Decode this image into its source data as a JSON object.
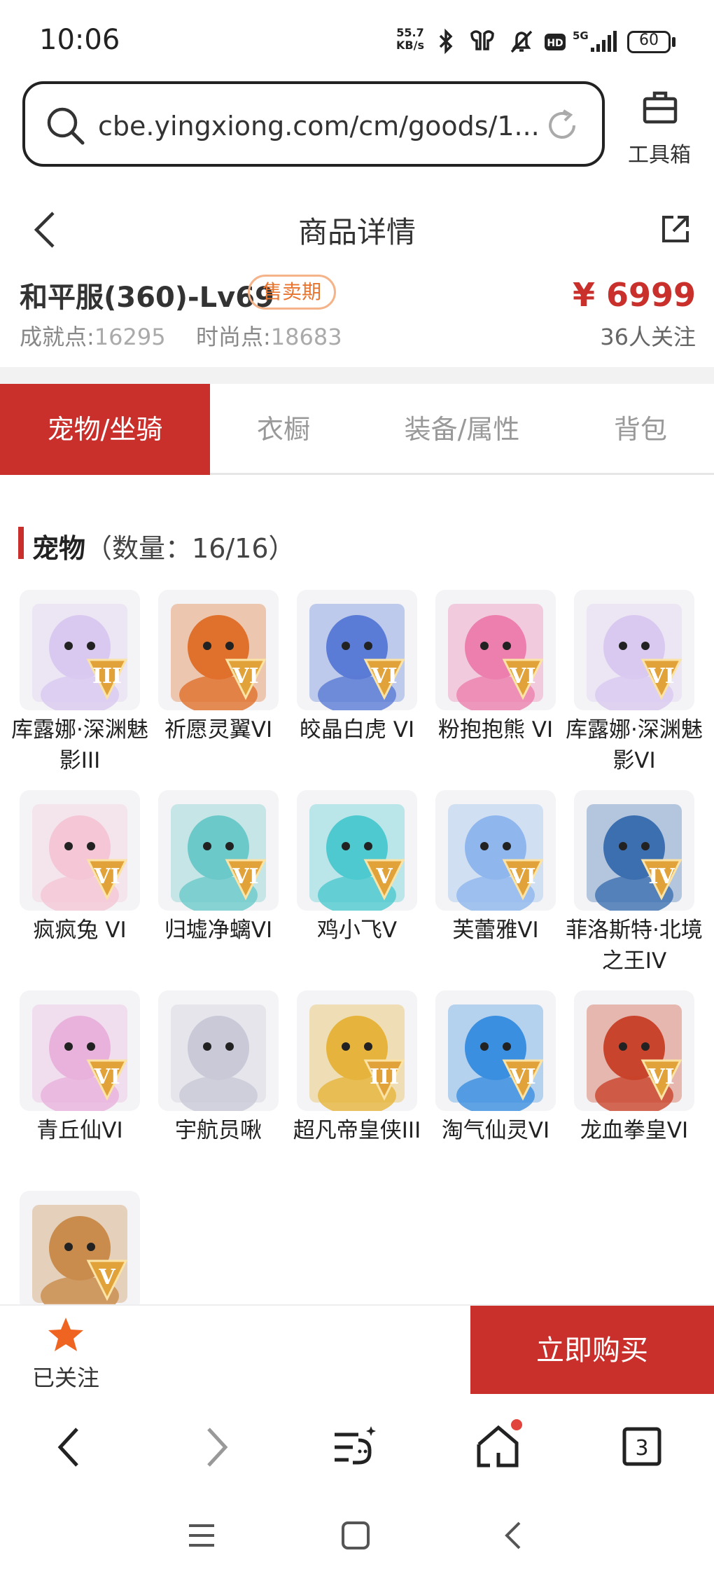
{
  "status_bar": {
    "time": "10:06",
    "net_speed_value": "55.7",
    "net_speed_unit": "KB/s",
    "battery": "60"
  },
  "browser": {
    "url": "cbe.yingxiong.com/cm/goods/1...",
    "toolbox_label": "工具箱",
    "tab_count": "3"
  },
  "header": {
    "title": "商品详情"
  },
  "product": {
    "name": "和平服(360)-Lv69",
    "badge": "售卖期",
    "price": "¥ 6999",
    "achievement_label": "成就点:",
    "achievement_value": "16295",
    "fashion_label": "时尚点:",
    "fashion_value": "18683",
    "followers": "36人关注"
  },
  "tabs": [
    {
      "label": "宠物/坐骑",
      "active": true
    },
    {
      "label": "衣橱",
      "active": false
    },
    {
      "label": "装备/属性",
      "active": false
    },
    {
      "label": "背包",
      "active": false
    }
  ],
  "section": {
    "title": "宠物",
    "count": "（数量：16/16）"
  },
  "pets": [
    {
      "name": "库露娜·深渊魅影III",
      "grade": "III",
      "icon": "pet-kuluna-icon",
      "color": "#d9c9f0"
    },
    {
      "name": "祈愿灵翼VI",
      "grade": "VI",
      "icon": "pet-eagle-icon",
      "color": "#e0712c"
    },
    {
      "name": "皎晶白虎 VI",
      "grade": "VI",
      "icon": "pet-white-tiger-icon",
      "color": "#5a7bd6"
    },
    {
      "name": "粉抱抱熊 VI",
      "grade": "VI",
      "icon": "pet-pink-bear-icon",
      "color": "#ec7fae"
    },
    {
      "name": "库露娜·深渊魅影VI",
      "grade": "VI",
      "icon": "pet-kuluna-icon",
      "color": "#d9c9f0"
    },
    {
      "name": "疯疯兔 VI",
      "grade": "VI",
      "icon": "pet-rabbit-icon",
      "color": "#f4c6d6"
    },
    {
      "name": "归墟净螭VI",
      "grade": "VI",
      "icon": "pet-dragon-icon",
      "color": "#6cc9c9"
    },
    {
      "name": "鸡小飞V",
      "grade": "V",
      "icon": "pet-chicken-icon",
      "color": "#4ec9d0"
    },
    {
      "name": "芙蕾雅VI",
      "grade": "VI",
      "icon": "pet-freya-icon",
      "color": "#8fb7ee"
    },
    {
      "name": "菲洛斯特·北境之王IV",
      "grade": "IV",
      "icon": "pet-frost-king-icon",
      "color": "#3c6fb0"
    },
    {
      "name": "青丘仙VI",
      "grade": "VI",
      "icon": "pet-fox-fairy-icon",
      "color": "#e9b2dc"
    },
    {
      "name": "宇航员啾",
      "grade": "",
      "icon": "pet-astronaut-icon",
      "color": "#c9c9d8"
    },
    {
      "name": "超凡帝皇侠III",
      "grade": "III",
      "icon": "pet-emperor-icon",
      "color": "#e6b43c"
    },
    {
      "name": "淘气仙灵VI",
      "grade": "VI",
      "icon": "pet-blue-dog-icon",
      "color": "#3b8fe0"
    },
    {
      "name": "龙血拳皇VI",
      "grade": "VI",
      "icon": "pet-dragon-boxer-icon",
      "color": "#c9442c"
    },
    {
      "name": "",
      "grade": "V",
      "icon": "pet-squirrel-icon",
      "color": "#c98c4c"
    }
  ],
  "actions": {
    "follow_label": "已关注",
    "buy_label": "立即购买"
  },
  "colors": {
    "accent": "#c9302c",
    "badge": "#e8742e",
    "star": "#f06421"
  }
}
